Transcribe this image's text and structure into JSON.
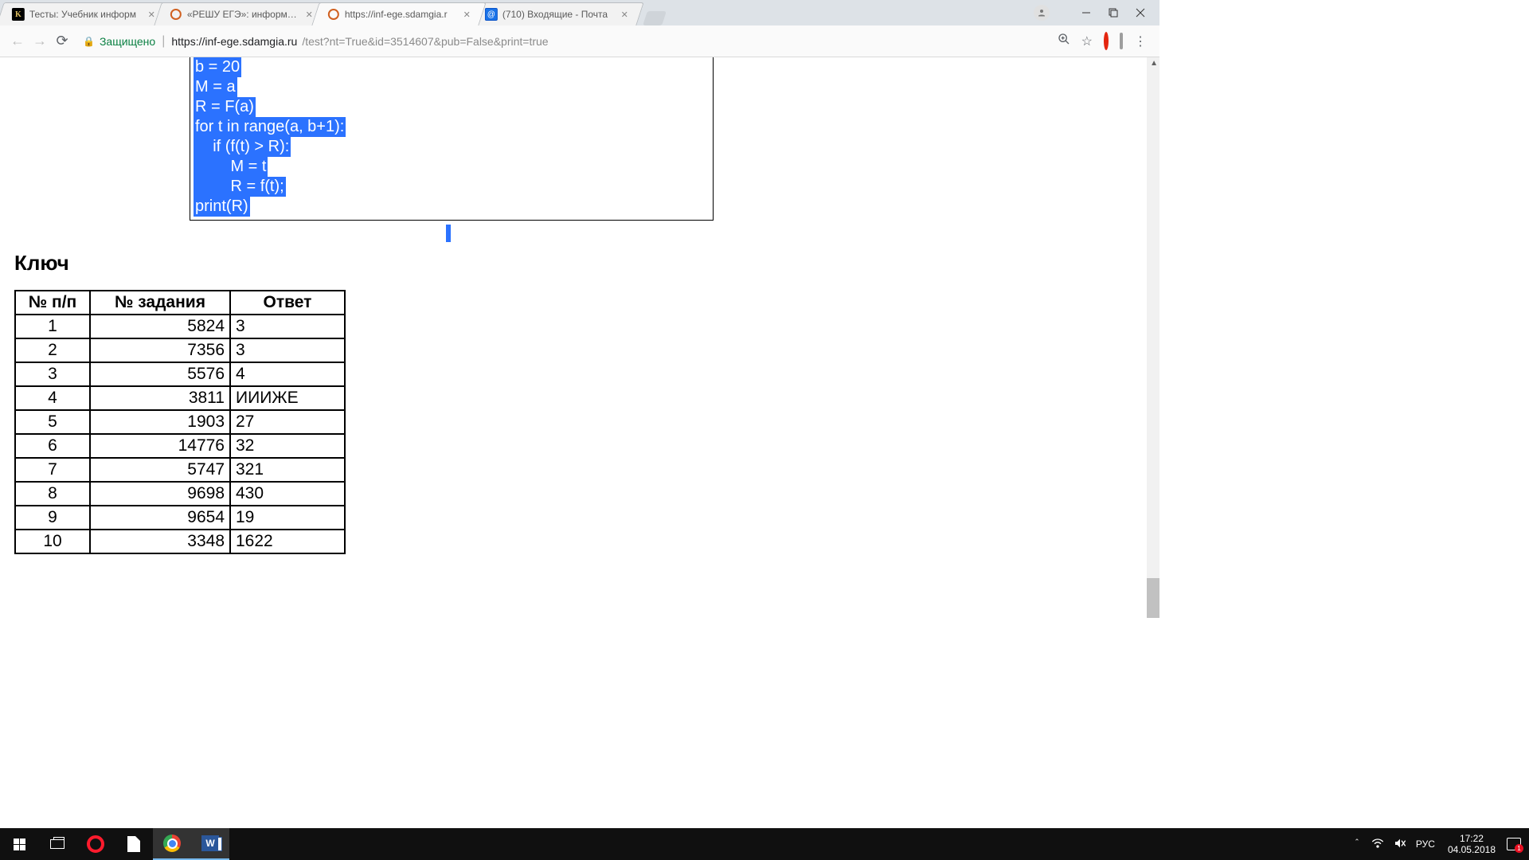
{
  "browser": {
    "tabs": [
      {
        "title": "Тесты: Учебник информ",
        "favicon": "k"
      },
      {
        "title": "«РЕШУ ЕГЭ»: информати",
        "favicon": "o"
      },
      {
        "title": "https://inf-ege.sdamgia.r",
        "favicon": "o",
        "active": true
      },
      {
        "title": "(710) Входящие - Почта",
        "favicon": "m"
      }
    ],
    "secure_label": "Защищено",
    "url_host": "https://inf-ege.sdamgia.ru",
    "url_path": "/test?nt=True&id=3514607&pub=False&print=true"
  },
  "code": {
    "lines": [
      "b = 20",
      "M = a",
      "R = F(a)",
      "for t in range(a, b+1):",
      "    if (f(t) > R):",
      "        M = t",
      "        R = f(t);",
      "print(R)"
    ]
  },
  "key": {
    "title": "Ключ",
    "headers": {
      "n": "№ п/п",
      "task": "№ задания",
      "answer": "Ответ"
    },
    "rows": [
      {
        "n": "1",
        "task": "5824",
        "answer": "3"
      },
      {
        "n": "2",
        "task": "7356",
        "answer": "3"
      },
      {
        "n": "3",
        "task": "5576",
        "answer": "4"
      },
      {
        "n": "4",
        "task": "3811",
        "answer": "ИИИЖЕ"
      },
      {
        "n": "5",
        "task": "1903",
        "answer": "27"
      },
      {
        "n": "6",
        "task": "14776",
        "answer": "32"
      },
      {
        "n": "7",
        "task": "5747",
        "answer": "321"
      },
      {
        "n": "8",
        "task": "9698",
        "answer": "430"
      },
      {
        "n": "9",
        "task": "9654",
        "answer": "19"
      },
      {
        "n": "10",
        "task": "3348",
        "answer": "1622"
      }
    ]
  },
  "taskbar": {
    "lang": "РУС",
    "time": "17:22",
    "date": "04.05.2018",
    "notif_count": "1"
  }
}
